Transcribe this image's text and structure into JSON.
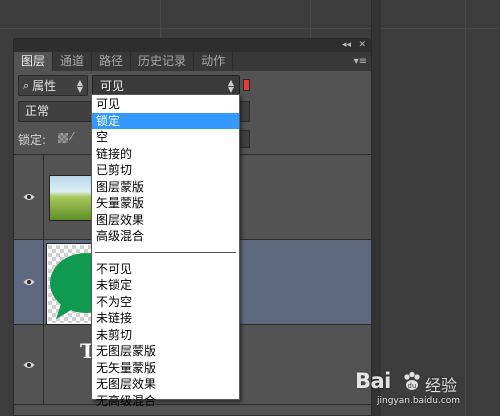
{
  "panel": {
    "collapse_glyph": "◂◂",
    "close_glyph": "✕",
    "menu_glyph": "▾≡",
    "tabs": [
      {
        "label": "图层"
      },
      {
        "label": "通道"
      },
      {
        "label": "路径"
      },
      {
        "label": "历史记录"
      },
      {
        "label": "动作"
      }
    ]
  },
  "filter": {
    "kind_label": "属性",
    "kind_icon": "search-icon",
    "visibility_value": "可见",
    "swatch_color": "#e23a3a"
  },
  "blend": {
    "mode": "正常"
  },
  "lock": {
    "label": "锁定:"
  },
  "layers": [
    {
      "name": "field-image",
      "visible": true
    },
    {
      "name": "speech-bubble",
      "visible": true,
      "selected": true
    },
    {
      "name": "text-layer",
      "visible": true,
      "text": "T"
    }
  ],
  "dropdown": {
    "group1": [
      {
        "label": "可见"
      },
      {
        "label": "锁定"
      },
      {
        "label": "空"
      },
      {
        "label": "链接的"
      },
      {
        "label": "已剪切"
      },
      {
        "label": "图层蒙版"
      },
      {
        "label": "矢量蒙版"
      },
      {
        "label": "图层效果"
      },
      {
        "label": "高级混合"
      }
    ],
    "group2": [
      {
        "label": "不可见"
      },
      {
        "label": "未锁定"
      },
      {
        "label": "不为空"
      },
      {
        "label": "未链接"
      },
      {
        "label": "未剪切"
      },
      {
        "label": "无图层蒙版"
      },
      {
        "label": "无矢量蒙版"
      },
      {
        "label": "无图层效果"
      },
      {
        "label": "无高级混合"
      }
    ],
    "highlighted": "锁定",
    "highlight_color": "#3399ff"
  },
  "watermark": {
    "logo_text": "Bai",
    "logo_suffix": "经验",
    "url": "jingyan.baidu.com"
  }
}
